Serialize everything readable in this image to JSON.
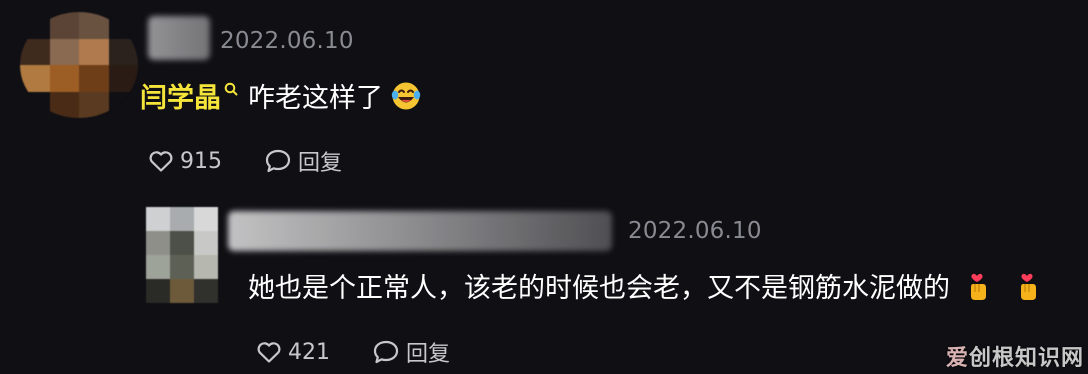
{
  "comments": [
    {
      "date": "2022.06.10",
      "mention": "闫学晶",
      "text": "咋老这样了",
      "emoji": "laughing-tears",
      "likes": "915",
      "reply_label": "回复"
    }
  ],
  "replies": [
    {
      "date": "2022.06.10",
      "text": "她也是个正常人，该老的时候也会老，又不是钢筋水泥做的",
      "emojis": [
        "heart-hands",
        "heart-hands"
      ],
      "likes": "421",
      "reply_label": "回复"
    }
  ],
  "watermark": {
    "accent": "爱",
    "rest": "创根知识网"
  },
  "colors": {
    "background": "#0f0f14",
    "mention": "#f5e53a",
    "muted": "#8a8a92"
  },
  "avatars": {
    "top_palette": [
      "#0f0f14",
      "#5b4436",
      "#6a5240",
      "#0f0f14",
      "#3f2a1e",
      "#8a6a50",
      "#b07a4e",
      "#2c221d",
      "#b07a40",
      "#9c5e24",
      "#6e3e18",
      "#2a1c14",
      "#0f0f14",
      "#4a2c16",
      "#5a3a20",
      "#0f0f14"
    ],
    "reply_palette": [
      "#cfd0d2",
      "#a9acae",
      "#d8d8d8",
      "#8f8f8a",
      "#4c5048",
      "#c8c9c6",
      "#9ea39a",
      "#5d6155",
      "#b6b8b0",
      "#2a2a26",
      "#6d5a3a",
      "#30302c"
    ]
  }
}
